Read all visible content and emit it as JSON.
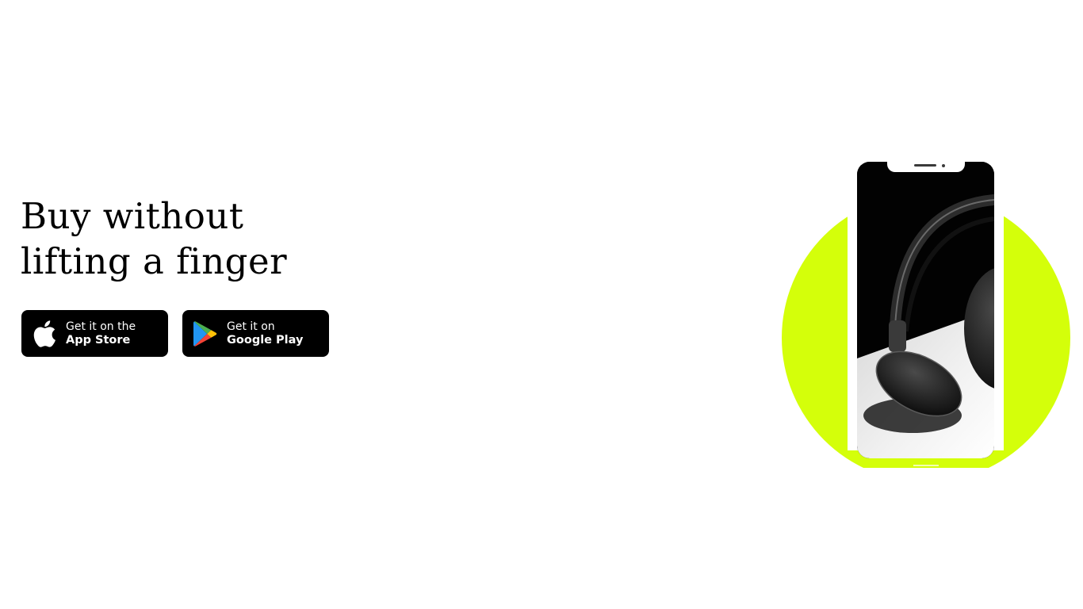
{
  "hero": {
    "headline_line1": "Buy without",
    "headline_line2": "lifting a finger"
  },
  "store_buttons": {
    "app_store": {
      "line1": "Get it on the",
      "line2": "App Store",
      "icon": "apple-icon"
    },
    "google_play": {
      "line1": "Get it on",
      "line2": "Google Play",
      "icon": "google-play-icon"
    }
  },
  "colors": {
    "accent": "#d4ff0a",
    "button_bg": "#000000",
    "text": "#000000"
  },
  "phone_mockup": {
    "screen_image": "headphones-photo"
  }
}
